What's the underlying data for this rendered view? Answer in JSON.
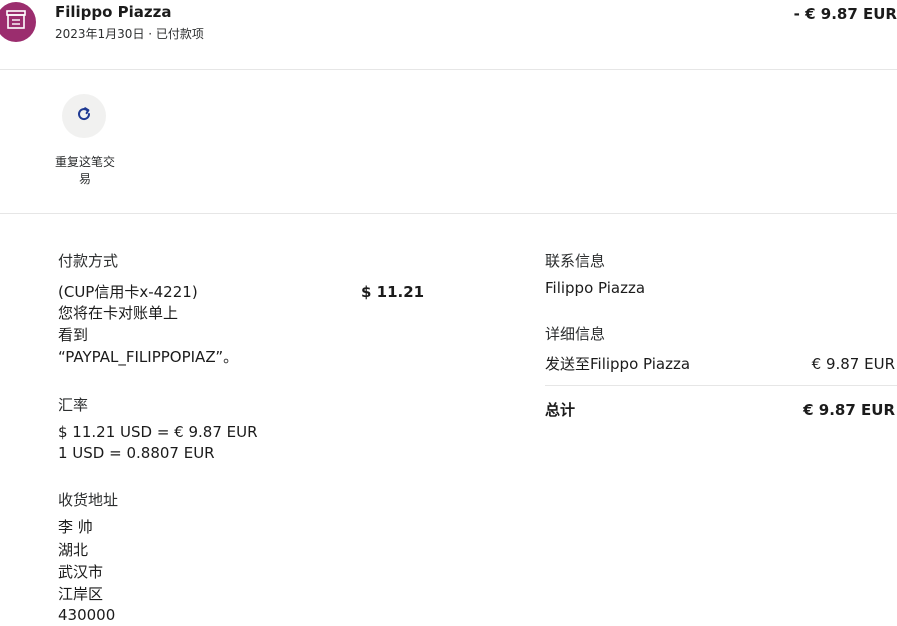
{
  "header": {
    "merchant": "Filippo Piazza",
    "date_status": "2023年1月30日 · 已付款项",
    "amount": "- € 9.87 EUR",
    "icon": "store-icon"
  },
  "actions": {
    "repeat_label": "重复这笔交易",
    "repeat_icon": "refresh-icon"
  },
  "payment": {
    "title": "付款方式",
    "method": "(CUP信用卡x-4221)",
    "amount": "$ 11.21",
    "note_lines": [
      "您将在卡对账单上",
      "看到",
      "“PAYPAL_FILIPPOPIAZ”。"
    ]
  },
  "exchange": {
    "title": "汇率",
    "line1": "$ 11.21 USD = € 9.87 EUR",
    "line2": "1 USD = 0.8807 EUR"
  },
  "shipping": {
    "title": "收货地址",
    "lines": [
      "李 帅",
      "湖北",
      "武汉市",
      "江岸区",
      "430000"
    ]
  },
  "contact": {
    "title": "联系信息",
    "name": "Filippo Piazza"
  },
  "details": {
    "title": "详细信息",
    "sent_label": "发送至Filippo Piazza",
    "sent_amount": "€ 9.87 EUR",
    "total_label": "总计",
    "total_amount": "€ 9.87 EUR"
  },
  "colors": {
    "avatar": "#9b2d6e",
    "accent": "#003087"
  }
}
